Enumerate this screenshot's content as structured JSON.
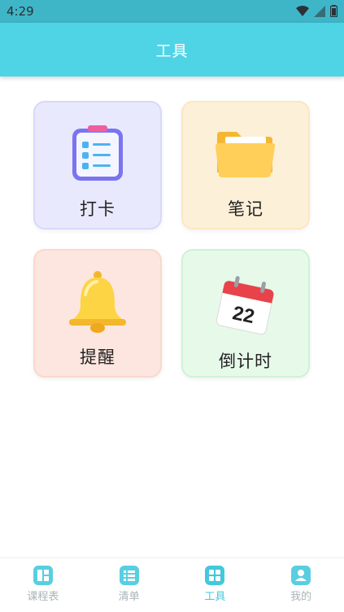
{
  "status_bar": {
    "time": "4:29"
  },
  "app_bar": {
    "title": "工具"
  },
  "tools": [
    {
      "label": "打卡",
      "icon": "clipboard-checklist-icon"
    },
    {
      "label": "笔记",
      "icon": "folder-icon"
    },
    {
      "label": "提醒",
      "icon": "bell-icon"
    },
    {
      "label": "倒计时",
      "icon": "calendar-icon",
      "calendar_day": "22"
    }
  ],
  "bottom_nav": {
    "items": [
      {
        "label": "课程表",
        "icon": "timetable-icon",
        "active": false
      },
      {
        "label": "清单",
        "icon": "list-icon",
        "active": false
      },
      {
        "label": "工具",
        "icon": "grid-icon",
        "active": true
      },
      {
        "label": "我的",
        "icon": "profile-icon",
        "active": false
      }
    ]
  },
  "colors": {
    "app_bar": "#4fd4e6",
    "status_bar": "#3fb6c8",
    "accent": "#43c8dc"
  }
}
